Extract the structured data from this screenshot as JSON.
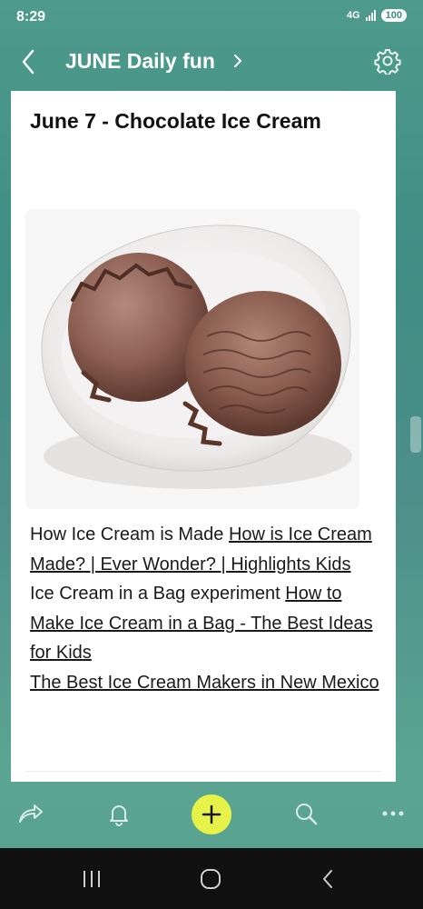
{
  "status": {
    "time": "8:29",
    "network": "4G",
    "battery": "100"
  },
  "header": {
    "title": "JUNE Daily fun"
  },
  "note": {
    "title": "June 7 - Chocolate Ice Cream",
    "lines": [
      {
        "plain": "How Ice Cream is Made ",
        "link": "How is Ice Cream Made? | Ever Wonder? | Highlights Kids"
      },
      {
        "plain": "Ice Cream in a Bag experiment ",
        "link": "How to Make Ice Cream in a Bag - The Best Ideas for Kids"
      },
      {
        "plain": "",
        "link": "The Best Ice Cream Makers in New Mexico"
      }
    ]
  },
  "icons": {
    "back": "chevron-left-icon",
    "title_chevron": "chevron-right-icon",
    "settings": "gear-icon",
    "share": "share-icon",
    "reminder": "bell-icon",
    "add": "plus-icon",
    "search": "search-icon",
    "more": "more-icon"
  },
  "colors": {
    "accent": "#e6f247",
    "header_bg": "#4e9b8c"
  }
}
